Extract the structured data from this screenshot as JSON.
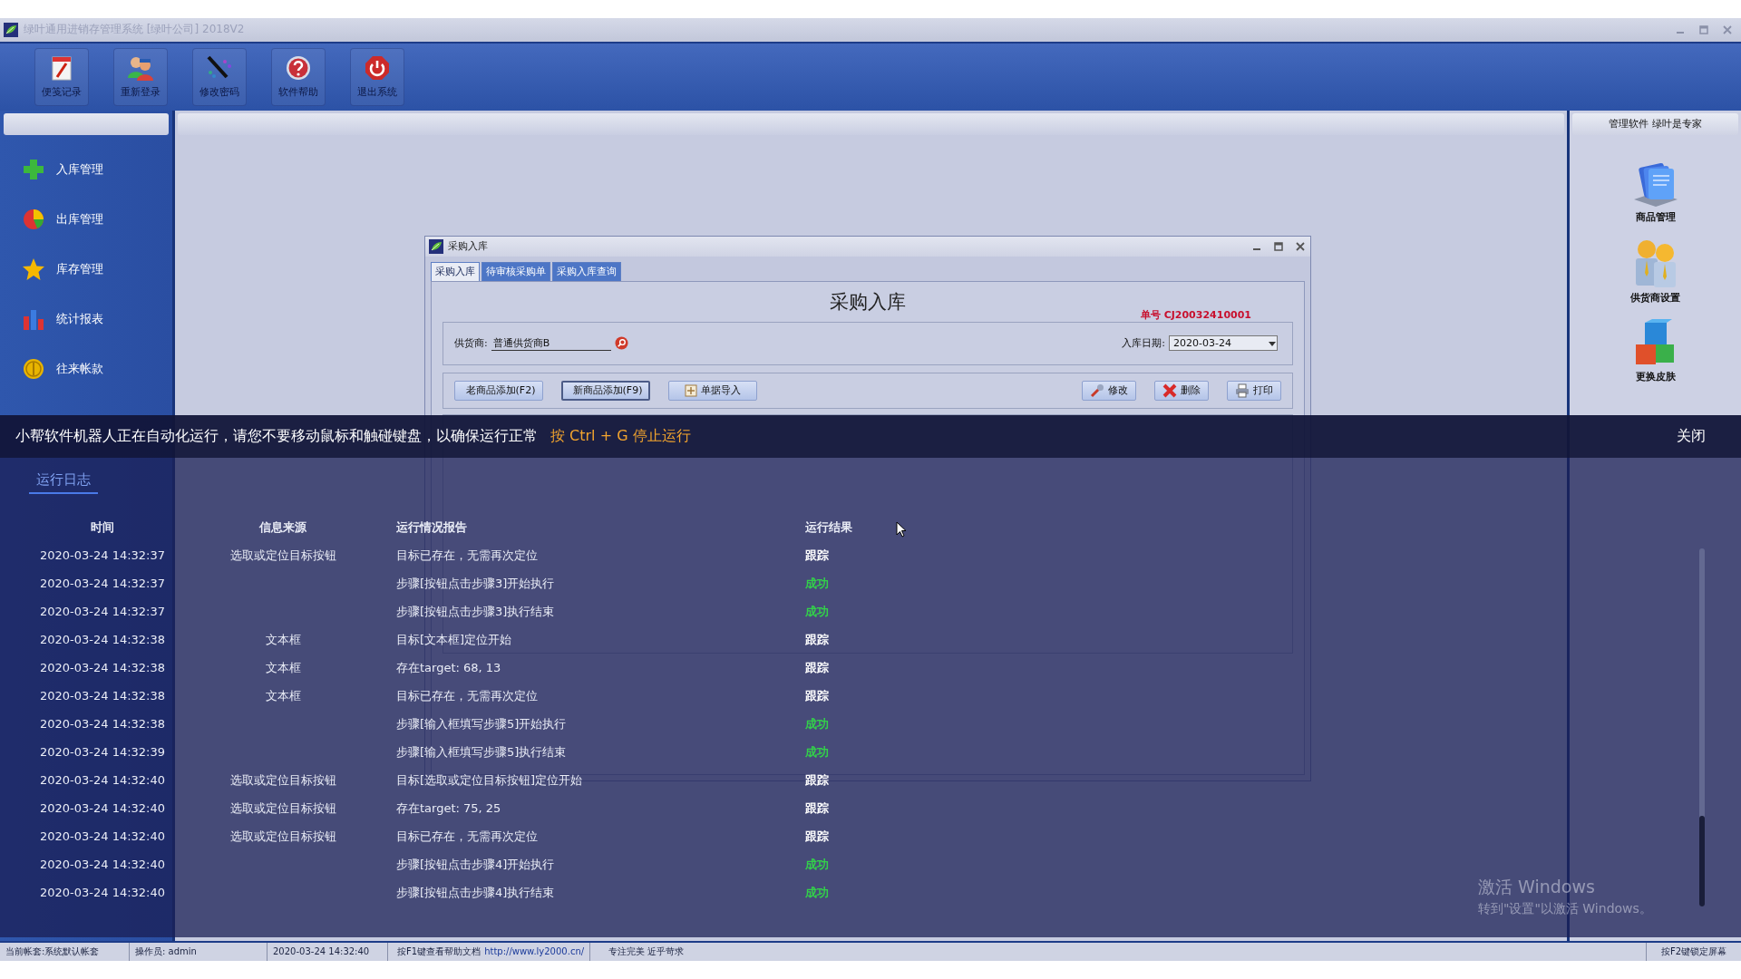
{
  "window": {
    "title": "绿叶通用进销存管理系统 [绿叶公司] 2018V2"
  },
  "toolbar": [
    {
      "label": "便笺记录"
    },
    {
      "label": "重新登录"
    },
    {
      "label": "修改密码"
    },
    {
      "label": "软件帮助"
    },
    {
      "label": "退出系统"
    }
  ],
  "sidebar": {
    "items": [
      {
        "label": "入库管理"
      },
      {
        "label": "出库管理"
      },
      {
        "label": "库存管理"
      },
      {
        "label": "统计报表"
      },
      {
        "label": "往来帐款"
      }
    ]
  },
  "right_panel": {
    "title": "管理软件  绿叶是专家",
    "items": [
      {
        "label": "商品管理"
      },
      {
        "label": "供货商设置"
      },
      {
        "label": "更换皮肤"
      }
    ]
  },
  "dialog": {
    "title": "采购入库",
    "tabs": [
      {
        "label": "采购入库",
        "selected": true
      },
      {
        "label": "待审核采购单",
        "selected": false
      },
      {
        "label": "采购入库查询",
        "selected": false
      }
    ],
    "heading": "采购入库",
    "order_no": "单号  CJ20032410001",
    "supplier": {
      "label": "供货商:",
      "value": "普通供货商B"
    },
    "date": {
      "label": "入库日期:",
      "value": "2020-03-24"
    },
    "buttons": [
      {
        "label": "老商品添加(F2)",
        "focused": false
      },
      {
        "label": "新商品添加(F9)",
        "focused": true
      },
      {
        "label": "单据导入",
        "focused": false
      },
      {
        "label": "修改",
        "focused": false
      },
      {
        "label": "删除",
        "focused": false
      },
      {
        "label": "打印",
        "focused": false
      }
    ]
  },
  "overlay": {
    "message": "小帮软件机器人正在自动化运行，请您不要移动鼠标和触碰键盘，以确保运行正常",
    "hint": "按 Ctrl + G 停止运行",
    "close": "关闭",
    "tabs": [
      {
        "label": "运行日志",
        "selected": true
      }
    ],
    "columns": [
      "时间",
      "信息来源",
      "运行情况报告",
      "运行结果"
    ],
    "rows": [
      {
        "time": "2020-03-24 14:32:37",
        "source": "选取或定位目标按钮",
        "report": "目标已存在，无需再次定位",
        "result": "跟踪",
        "kind": "trace"
      },
      {
        "time": "2020-03-24 14:32:37",
        "source": "",
        "report": "步骤[按钮点击步骤3]开始执行",
        "result": "成功",
        "kind": "success"
      },
      {
        "time": "2020-03-24 14:32:37",
        "source": "",
        "report": "步骤[按钮点击步骤3]执行结束",
        "result": "成功",
        "kind": "success"
      },
      {
        "time": "2020-03-24 14:32:38",
        "source": "文本框",
        "report": "目标[文本框]定位开始",
        "result": "跟踪",
        "kind": "trace"
      },
      {
        "time": "2020-03-24 14:32:38",
        "source": "文本框",
        "report": "存在target: 68, 13",
        "result": "跟踪",
        "kind": "trace"
      },
      {
        "time": "2020-03-24 14:32:38",
        "source": "文本框",
        "report": "目标已存在，无需再次定位",
        "result": "跟踪",
        "kind": "trace"
      },
      {
        "time": "2020-03-24 14:32:38",
        "source": "",
        "report": "步骤[输入框填写步骤5]开始执行",
        "result": "成功",
        "kind": "success"
      },
      {
        "time": "2020-03-24 14:32:39",
        "source": "",
        "report": "步骤[输入框填写步骤5]执行结束",
        "result": "成功",
        "kind": "success"
      },
      {
        "time": "2020-03-24 14:32:40",
        "source": "选取或定位目标按钮",
        "report": "目标[选取或定位目标按钮]定位开始",
        "result": "跟踪",
        "kind": "trace"
      },
      {
        "time": "2020-03-24 14:32:40",
        "source": "选取或定位目标按钮",
        "report": "存在target: 75, 25",
        "result": "跟踪",
        "kind": "trace"
      },
      {
        "time": "2020-03-24 14:32:40",
        "source": "选取或定位目标按钮",
        "report": "目标已存在，无需再次定位",
        "result": "跟踪",
        "kind": "trace"
      },
      {
        "time": "2020-03-24 14:32:40",
        "source": "",
        "report": "步骤[按钮点击步骤4]开始执行",
        "result": "成功",
        "kind": "success"
      },
      {
        "time": "2020-03-24 14:32:40",
        "source": "",
        "report": "步骤[按钮点击步骤4]执行结束",
        "result": "成功",
        "kind": "success"
      }
    ]
  },
  "activation": {
    "title": "激活 Windows",
    "subtitle": "转到\"设置\"以激活 Windows。"
  },
  "status_bar": {
    "items": [
      "当前帐套:系统默认帐套",
      "操作员: admin",
      "2020-03-24 14:32:40",
      "按F1键查看帮助文档",
      "专注完美 近乎苛求"
    ],
    "link": "http://www.ly2000.cn/",
    "right": "按F2键锁定屏幕"
  }
}
